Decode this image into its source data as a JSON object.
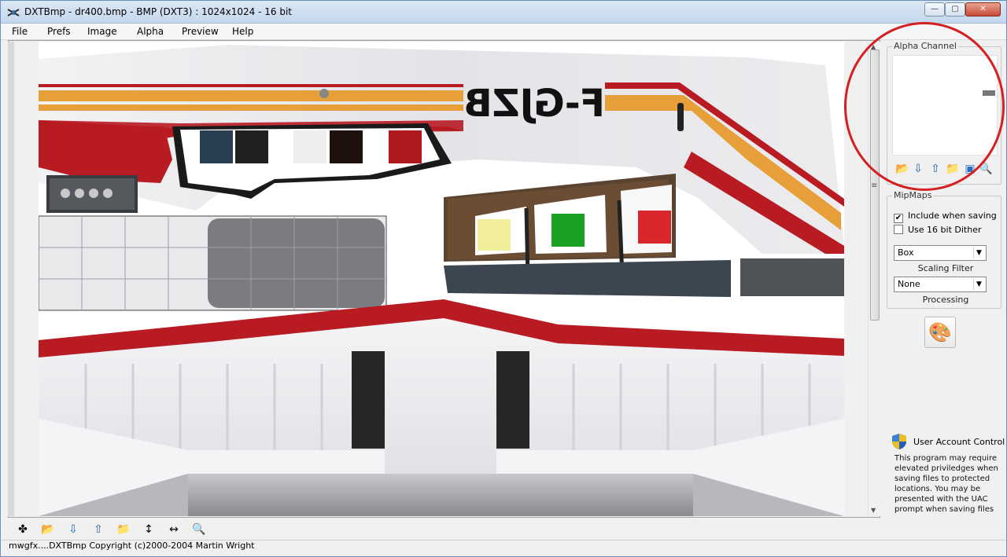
{
  "window": {
    "title": "DXTBmp - dr400.bmp - BMP (DXT3) : 1024x1024 - 16 bit",
    "min_glyph": "—",
    "max_glyph": "▢",
    "close_glyph": "✕"
  },
  "menu": {
    "items": [
      {
        "label": "File"
      },
      {
        "label": "Prefs"
      },
      {
        "label": "Image"
      },
      {
        "label": "Alpha"
      },
      {
        "label": "Preview"
      },
      {
        "label": "Help"
      }
    ]
  },
  "canvas": {
    "registration": "F-GJZB",
    "scroll_up_glyph": "▲",
    "scroll_down_glyph": "▼",
    "scroll_grip_glyph": "≡"
  },
  "alpha_channel": {
    "legend": "Alpha Channel",
    "tools": [
      {
        "icon": "open-folder-icon",
        "glyph": "📂"
      },
      {
        "icon": "import-icon",
        "glyph": "⇩"
      },
      {
        "icon": "export-icon",
        "glyph": "⇧"
      },
      {
        "icon": "folder-icon",
        "glyph": "📁"
      },
      {
        "icon": "image-icon",
        "glyph": "▣"
      },
      {
        "icon": "zoom-icon",
        "glyph": "🔍"
      }
    ]
  },
  "mipmaps": {
    "legend": "MipMaps",
    "include_when_saving": {
      "label": "Include when saving",
      "checked": true,
      "check_glyph": "✔"
    },
    "use_16bit_dither": {
      "label": "Use 16 bit Dither",
      "checked": false
    },
    "scaling_filter": {
      "value": "Box",
      "caption": "Scaling Filter"
    },
    "processing": {
      "value": "None",
      "caption": "Processing"
    },
    "select_arrow_glyph": "▼"
  },
  "palette_button": {
    "icon": "palette-icon",
    "glyph": "🎨"
  },
  "uac": {
    "title": "User Account Control",
    "text": "This program may require elevated priviledges when saving files to protected locations. You may be presented with the UAC prompt when saving files"
  },
  "bottom_toolbar": [
    {
      "icon": "crosshair-icon",
      "glyph": "✤"
    },
    {
      "icon": "open-folder-icon",
      "glyph": "📂"
    },
    {
      "icon": "import-icon",
      "glyph": "⇩"
    },
    {
      "icon": "export-icon",
      "glyph": "⇧"
    },
    {
      "icon": "folder-icon",
      "glyph": "📁"
    },
    {
      "icon": "resize-vertical-icon",
      "glyph": "↕"
    },
    {
      "icon": "resize-horizontal-icon",
      "glyph": "↔"
    },
    {
      "icon": "zoom-icon",
      "glyph": "🔍"
    }
  ],
  "status": {
    "text": "mwgfx....DXTBmp Copyright (c)2000-2004 Martin Wright"
  },
  "colors": {
    "accent_red": "#b81b22",
    "stripe_orange": "#e7a039",
    "annotation": "#d52020"
  }
}
